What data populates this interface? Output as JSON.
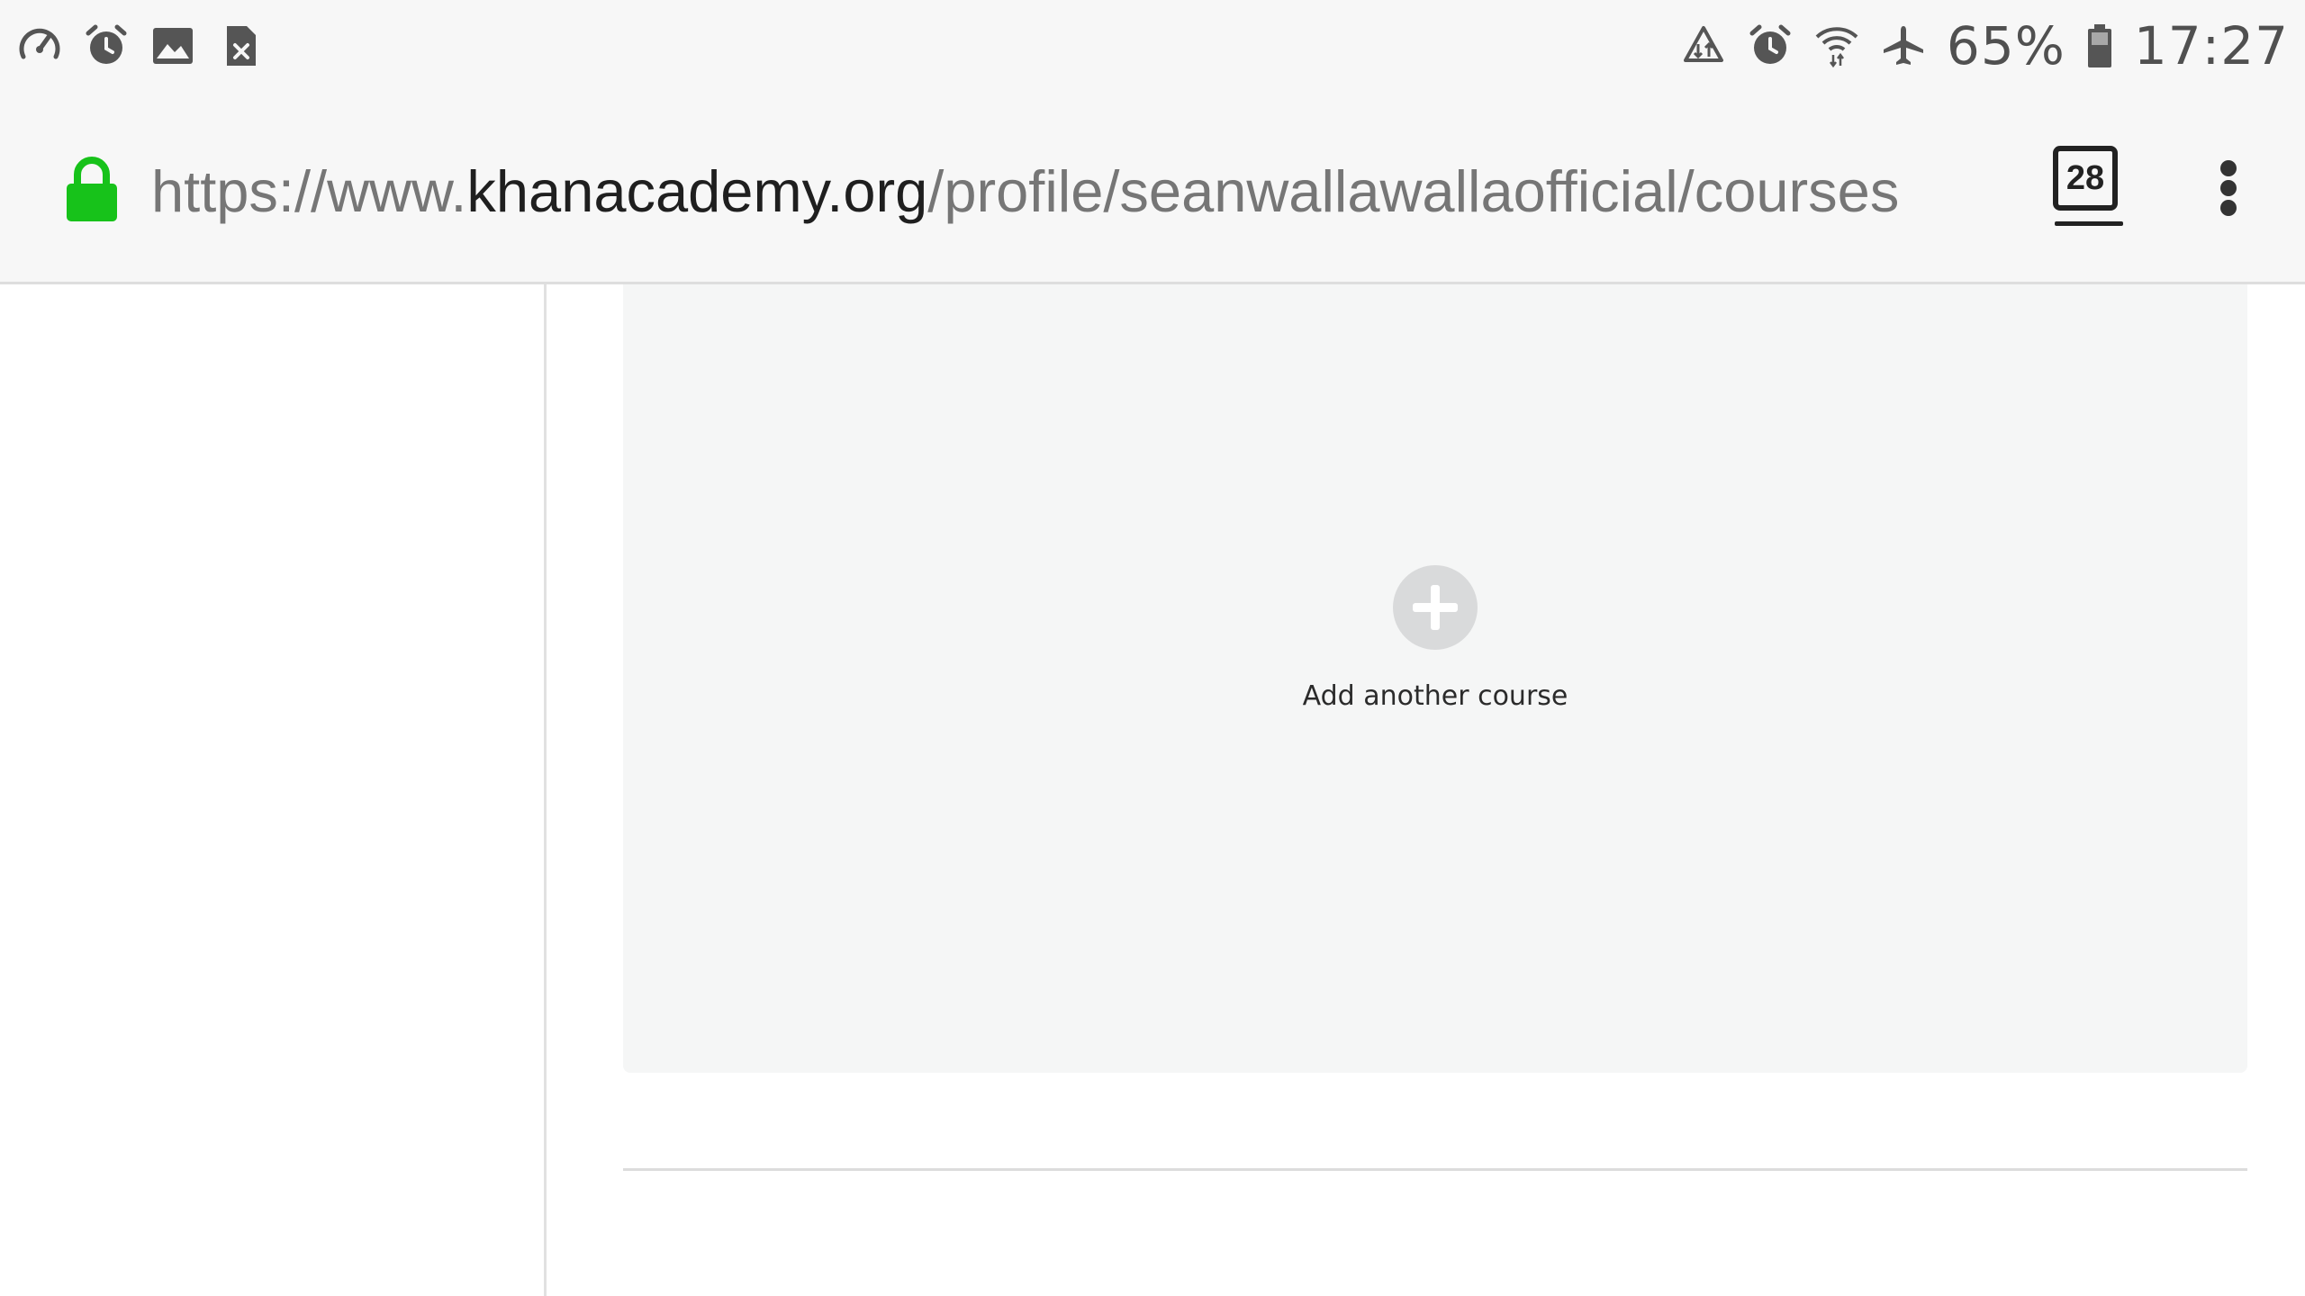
{
  "status_bar": {
    "left_icons": [
      "speedometer-icon",
      "alarm-clock-icon",
      "image-icon",
      "sim-card-error-icon"
    ],
    "right_icons": [
      "data-sync-icon",
      "alarm-clock-icon",
      "wifi-icon",
      "airplane-mode-icon",
      "battery-icon"
    ],
    "battery_percent": "65%",
    "time": "17:27"
  },
  "browser": {
    "url_scheme_prefix": "https://www.",
    "url_domain": "khanacademy.org",
    "url_path": "/profile/seanwallawallaofficial/courses",
    "tab_count": "28",
    "lock_color": "#17c21a"
  },
  "main": {
    "add_course_label": "Add another course"
  }
}
